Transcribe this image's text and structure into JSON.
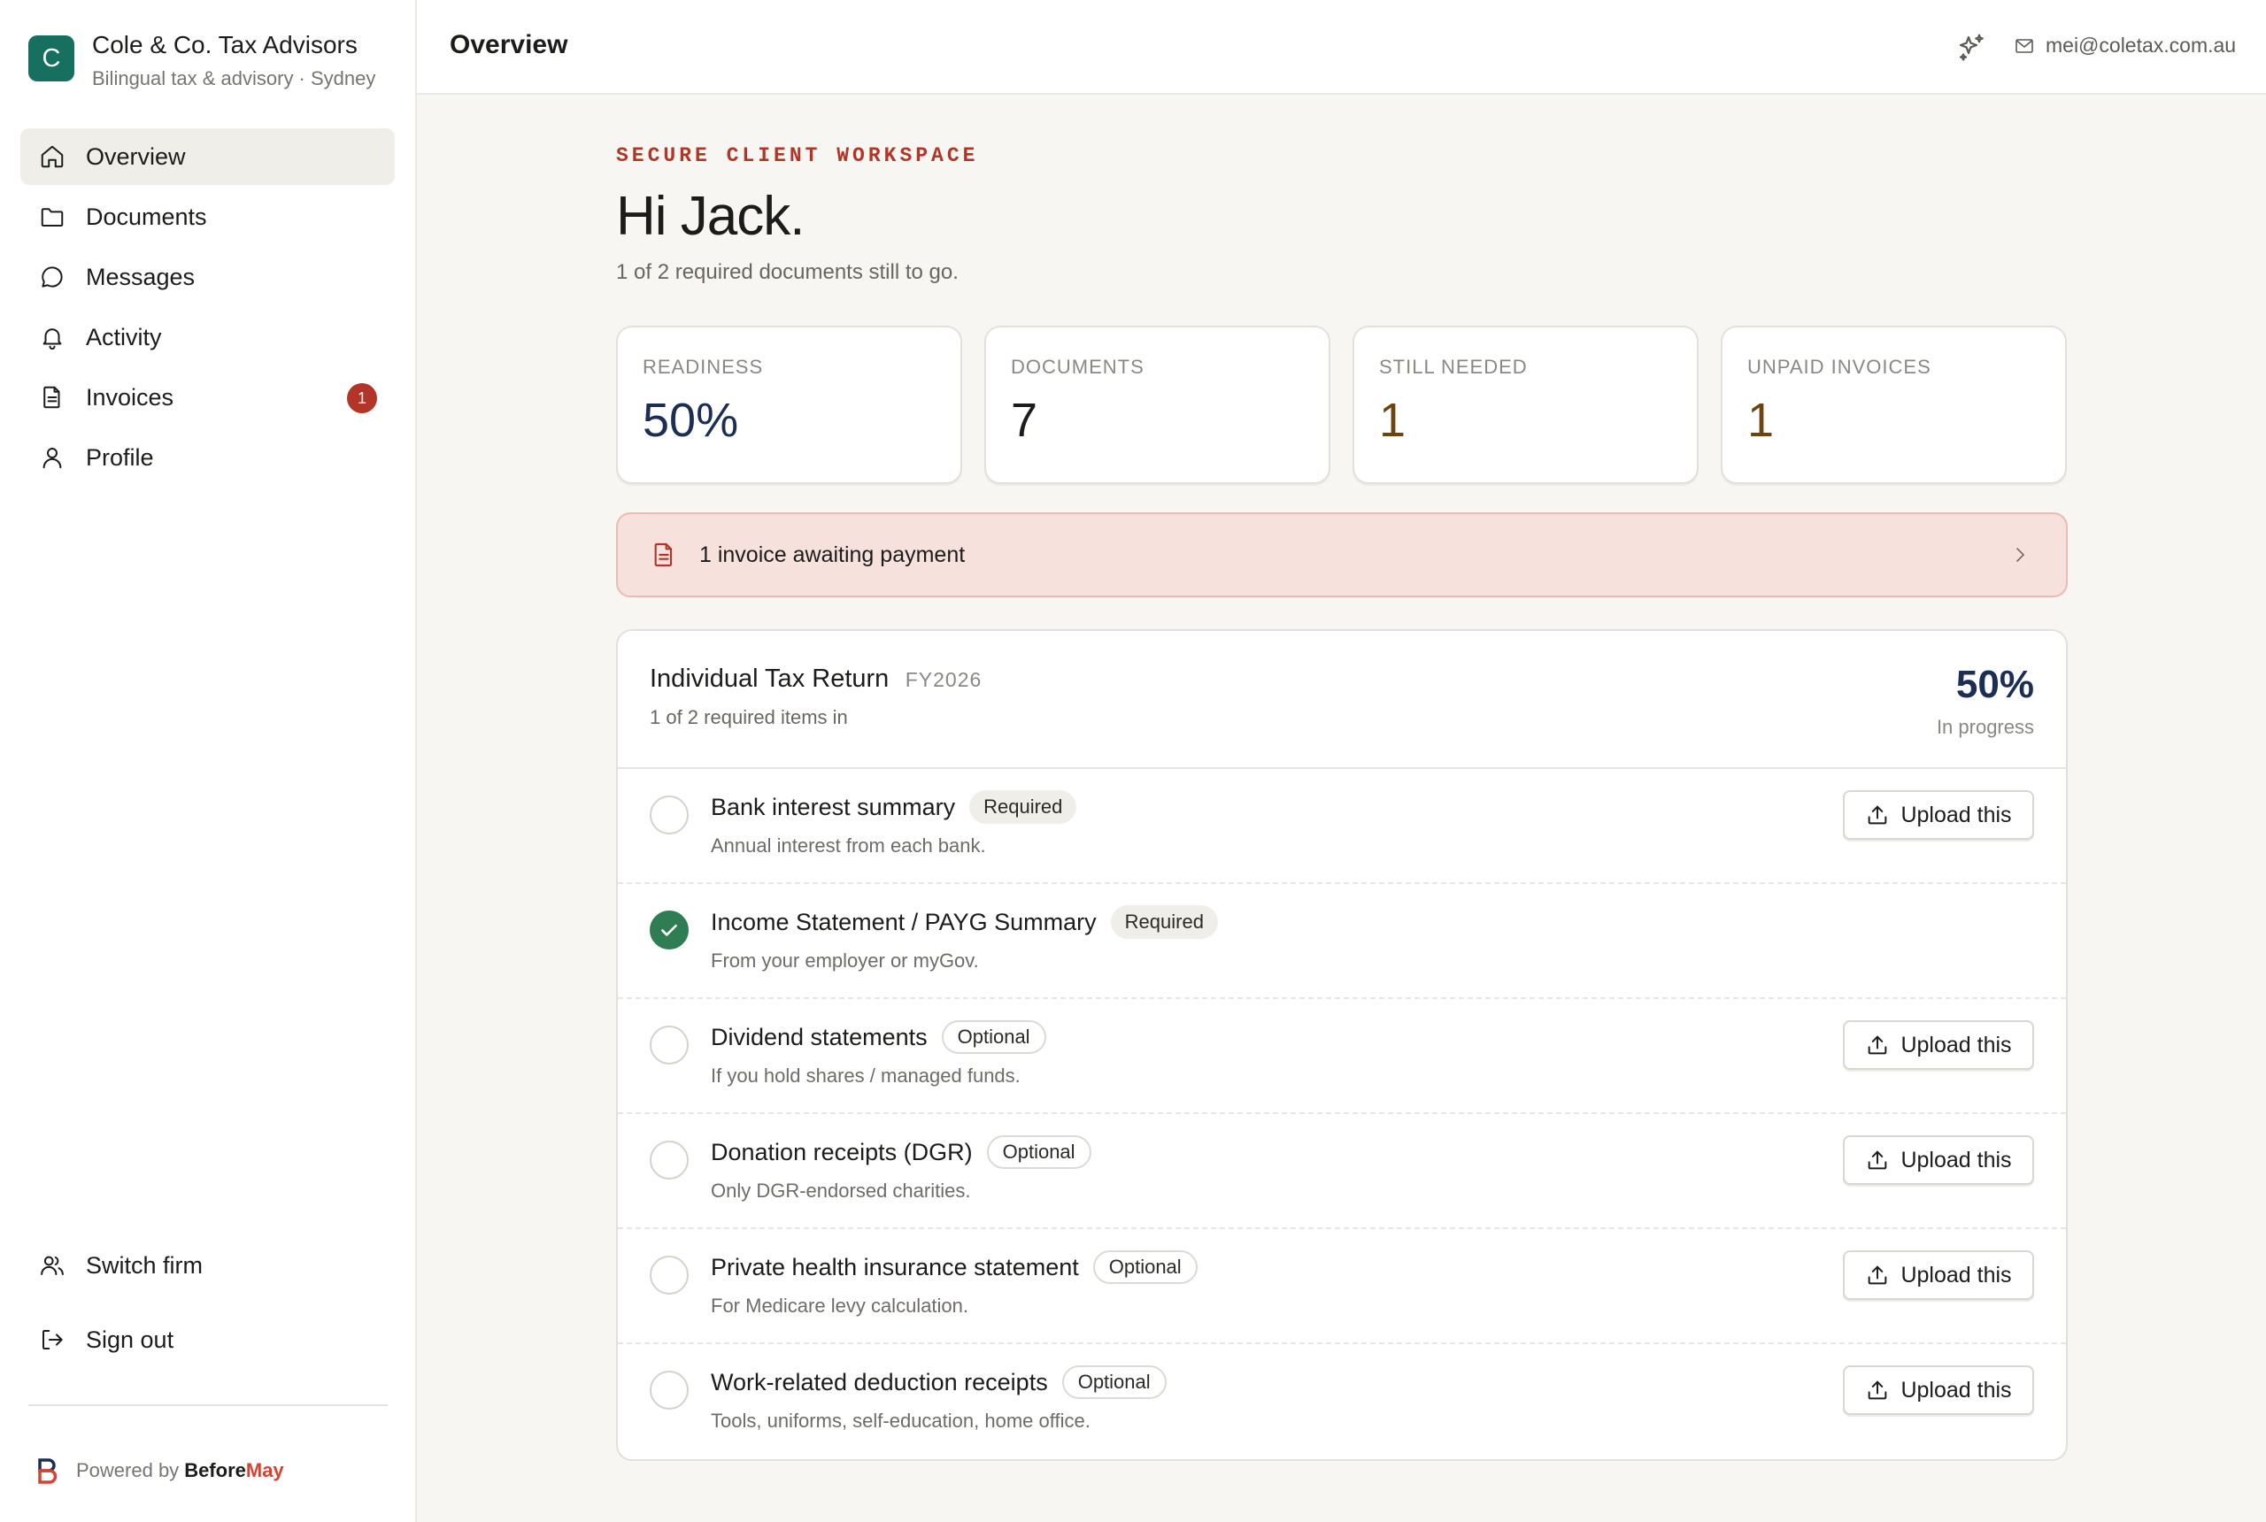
{
  "brand": {
    "initial": "C",
    "name": "Cole & Co. Tax Advisors",
    "subtitle": "Bilingual tax & advisory · Sydney"
  },
  "nav": {
    "items": [
      {
        "label": "Overview",
        "icon": "home-icon",
        "active": true
      },
      {
        "label": "Documents",
        "icon": "folder-icon"
      },
      {
        "label": "Messages",
        "icon": "chat-bubble-icon"
      },
      {
        "label": "Activity",
        "icon": "bell-icon"
      },
      {
        "label": "Invoices",
        "icon": "document-icon",
        "badge": "1"
      },
      {
        "label": "Profile",
        "icon": "user-icon"
      }
    ],
    "bottom": [
      {
        "label": "Switch firm",
        "icon": "users-icon"
      },
      {
        "label": "Sign out",
        "icon": "sign-out-icon"
      }
    ]
  },
  "footer": {
    "prefix": "Powered by",
    "brand_a": "Before",
    "brand_b": "May"
  },
  "topbar": {
    "title": "Overview",
    "email": "mei@coletax.com.au"
  },
  "hero": {
    "eyebrow": "SECURE CLIENT WORKSPACE",
    "greeting": "Hi Jack.",
    "subline": "1 of 2 required documents still to go."
  },
  "stats": [
    {
      "label": "READINESS",
      "value": "50%",
      "color": "#1d2e55"
    },
    {
      "label": "DOCUMENTS",
      "value": "7",
      "color": "#1c1c1a"
    },
    {
      "label": "STILL NEEDED",
      "value": "1",
      "color": "#6b4510"
    },
    {
      "label": "UNPAID INVOICES",
      "value": "1",
      "color": "#6b4510"
    }
  ],
  "alert": {
    "text": "1 invoice awaiting payment"
  },
  "return_card": {
    "title": "Individual Tax Return",
    "fy": "FY2026",
    "subtitle": "1 of 2 required items in",
    "percent": "50%",
    "status": "In progress",
    "upload_label": "Upload this",
    "items": [
      {
        "title": "Bank interest summary",
        "tag": "Required",
        "desc": "Annual interest from each bank.",
        "done": false
      },
      {
        "title": "Income Statement / PAYG Summary",
        "tag": "Required",
        "desc": "From your employer or myGov.",
        "done": true
      },
      {
        "title": "Dividend statements",
        "tag": "Optional",
        "desc": "If you hold shares / managed funds.",
        "done": false
      },
      {
        "title": "Donation receipts (DGR)",
        "tag": "Optional",
        "desc": "Only DGR-endorsed charities.",
        "done": false
      },
      {
        "title": "Private health insurance statement",
        "tag": "Optional",
        "desc": "For Medicare levy calculation.",
        "done": false
      },
      {
        "title": "Work-related deduction receipts",
        "tag": "Optional",
        "desc": "Tools, uniforms, self-education, home office.",
        "done": false
      }
    ]
  },
  "colors": {
    "brand": "#17705f",
    "alert_bg": "#f6e1dd",
    "badge": "#b23527",
    "done": "#2f7d52"
  }
}
